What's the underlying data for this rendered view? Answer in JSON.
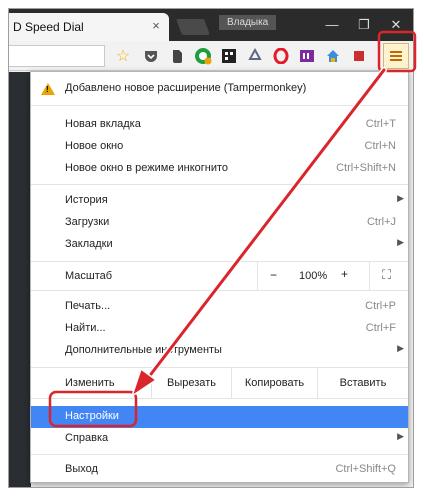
{
  "titlebar": {
    "tab_title": "D Speed Dial",
    "tab_close": "×",
    "profile_name": "Владыка",
    "minimize": "—",
    "restore": "❐",
    "close": "✕"
  },
  "toolbar": {
    "star": "☆",
    "menu_button_color": "#c26a00"
  },
  "menu": {
    "extension_notice": "Добавлено новое расширение (Tampermonkey)",
    "items": {
      "new_tab": {
        "label": "Новая вкладка",
        "shortcut": "Ctrl+T"
      },
      "new_window": {
        "label": "Новое окно",
        "shortcut": "Ctrl+N"
      },
      "incognito": {
        "label": "Новое окно в режиме инкогнито",
        "shortcut": "Ctrl+Shift+N"
      },
      "history": {
        "label": "История",
        "arrow": "▶"
      },
      "downloads": {
        "label": "Загрузки",
        "shortcut": "Ctrl+J"
      },
      "bookmarks": {
        "label": "Закладки",
        "arrow": "▶"
      },
      "print": {
        "label": "Печать...",
        "shortcut": "Ctrl+P"
      },
      "find": {
        "label": "Найти...",
        "shortcut": "Ctrl+F"
      },
      "more_tools": {
        "label": "Дополнительные инструменты",
        "arrow": "▶"
      },
      "settings": {
        "label": "Настройки"
      },
      "help": {
        "label": "Справка",
        "arrow": "▶"
      },
      "exit": {
        "label": "Выход",
        "shortcut": "Ctrl+Shift+Q"
      }
    },
    "zoom": {
      "label": "Масштаб",
      "minus": "−",
      "value": "100%",
      "plus": "+",
      "fullscreen": "⛶"
    },
    "edit": {
      "label": "Изменить",
      "cut": "Вырезать",
      "copy": "Копировать",
      "paste": "Вставить"
    },
    "highlight_color": "#4285f4"
  },
  "annotation_color": "#d9252b"
}
